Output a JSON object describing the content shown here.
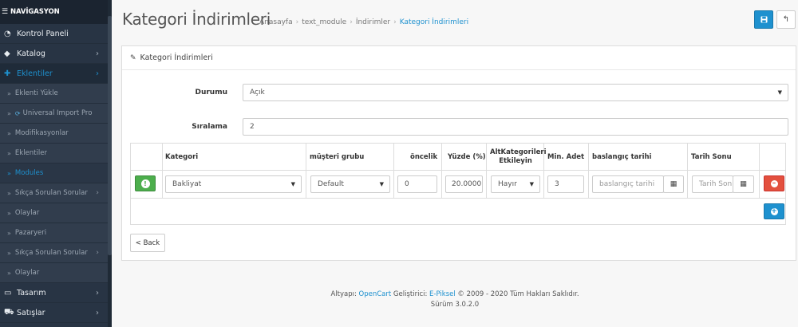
{
  "sidebar": {
    "header": "NAVİGASYON",
    "items": [
      {
        "label": "Kontrol Paneli",
        "icon": "dashboard-icon"
      },
      {
        "label": "Katalog",
        "icon": "tag-icon"
      },
      {
        "label": "Eklentiler",
        "icon": "puzzle-icon"
      },
      {
        "label": "Eklenti Yükle"
      },
      {
        "label": "Universal Import Pro"
      },
      {
        "label": "Modifikasyonlar"
      },
      {
        "label": "Eklentiler"
      },
      {
        "label": "Modules"
      },
      {
        "label": "Sıkça Sorulan Sorular"
      },
      {
        "label": "Olaylar"
      },
      {
        "label": "Pazaryeri"
      },
      {
        "label": "Sıkça Sorulan Sorular"
      },
      {
        "label": "Olaylar"
      },
      {
        "label": "Tasarım",
        "icon": "monitor-icon"
      },
      {
        "label": "Satışlar",
        "icon": "cart-icon"
      }
    ]
  },
  "header": {
    "title": "Kategori İndirimleri",
    "breadcrumb": [
      "Anasayfa",
      "text_module",
      "İndirimler",
      "Kategori İndirimleri"
    ]
  },
  "panel": {
    "heading": "Kategori İndirimleri"
  },
  "form": {
    "durum_label": "Durumu",
    "durum_value": "Açık",
    "siralama_label": "Sıralama",
    "siralama_value": "2"
  },
  "table": {
    "headers": [
      "Kategori",
      "müşteri grubu",
      "öncelik",
      "Yüzde (%)",
      "AltKategorileri",
      "Etkileyin",
      "Min. Adet",
      "baslangıç tarihi",
      "Tarih Sonu"
    ],
    "row": {
      "kategori": "Bakliyat",
      "musteri_grubu": "Default",
      "oncelik": "0",
      "yuzde": "20.0000",
      "alt_kategori": "Hayır",
      "min_adet": "3",
      "baslangic_placeholder": "baslangıç tarihi",
      "tarih_sonu_placeholder": "Tarih Sonu"
    }
  },
  "back_label": "< Back",
  "footer": {
    "prefix": "Altyapı: ",
    "opencart": "OpenCart",
    "middle": " Geliştirici: ",
    "epiksel": "E-Piksel",
    "suffix": " © 2009 - 2020 Tüm Hakları Saklıdır.",
    "version": "Sürüm 3.0.2.0"
  },
  "colors": {
    "accent": "#1e91cf",
    "success": "#4cae4c",
    "danger": "#e3503e",
    "sidebar": "#283444"
  }
}
